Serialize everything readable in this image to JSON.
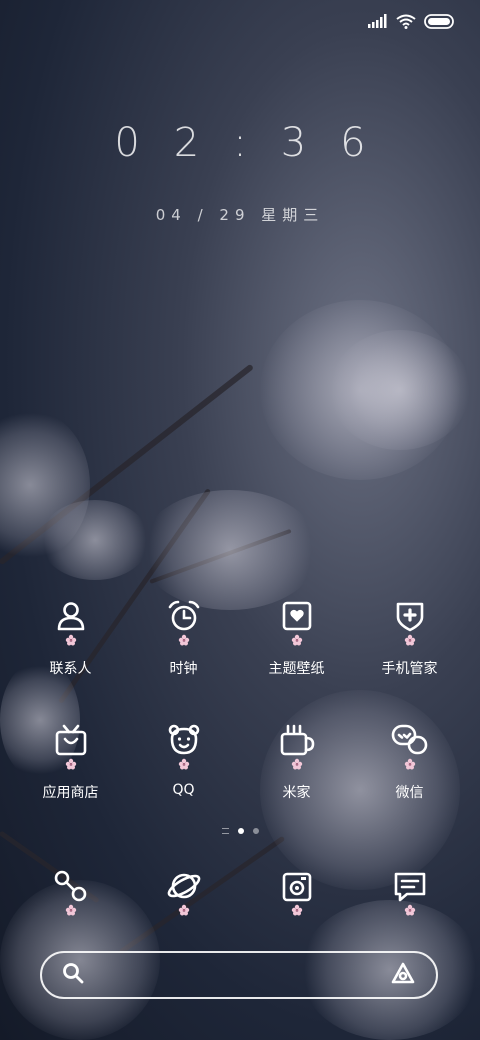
{
  "status_bar": {
    "signal_icon": "signal-icon",
    "wifi_icon": "wifi-icon",
    "battery_icon": "battery-icon"
  },
  "clock": {
    "time": "02:36"
  },
  "date": {
    "text": "04 / 29  星期三"
  },
  "apps_row1": [
    {
      "label": "联系人",
      "icon": "contacts-icon"
    },
    {
      "label": "时钟",
      "icon": "alarm-clock-icon"
    },
    {
      "label": "主题壁纸",
      "icon": "theme-wallpaper-icon"
    },
    {
      "label": "手机管家",
      "icon": "security-shield-icon"
    }
  ],
  "apps_row2": [
    {
      "label": "应用商店",
      "icon": "app-store-icon"
    },
    {
      "label": "QQ",
      "icon": "qq-icon"
    },
    {
      "label": "米家",
      "icon": "mijia-icon"
    },
    {
      "label": "微信",
      "icon": "wechat-icon"
    }
  ],
  "dock": [
    {
      "icon": "phone-icon"
    },
    {
      "icon": "browser-icon"
    },
    {
      "icon": "camera-icon"
    },
    {
      "icon": "messages-icon"
    }
  ],
  "page_indicator": {
    "pages": 2,
    "current": 1
  },
  "search_bar": {
    "search_icon": "search-icon",
    "assistant_icon": "assistant-icon"
  },
  "colors": {
    "icon_stroke": "#ffffff",
    "flower_badge": "#f2c7d8"
  }
}
